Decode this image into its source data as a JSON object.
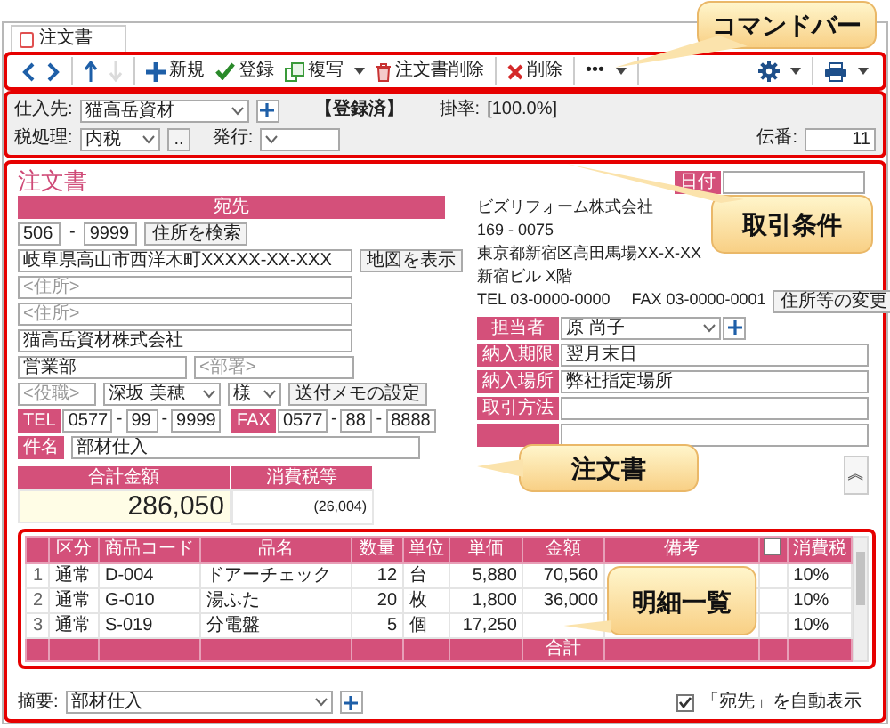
{
  "tab": {
    "label": "注文書",
    "selected": true
  },
  "toolbar": {
    "groups": [
      {
        "items": [
          {
            "kind": "prev",
            "disabled": false,
            "dropdown": false
          },
          {
            "kind": "next",
            "disabled": false,
            "dropdown": false
          }
        ]
      },
      {
        "items": [
          {
            "kind": "up",
            "disabled": false,
            "dropdown": false
          },
          {
            "kind": "down",
            "disabled": true,
            "dropdown": false
          }
        ]
      },
      {
        "items": [
          {
            "kind": "new",
            "label": "新規",
            "disabled": false,
            "dropdown": false
          },
          {
            "kind": "save",
            "label": "登録",
            "disabled": false,
            "dropdown": false
          },
          {
            "kind": "copy",
            "label": "複写",
            "disabled": false,
            "dropdown": true
          },
          {
            "kind": "trash",
            "label": "注文書削除",
            "disabled": false,
            "dropdown": false
          }
        ]
      },
      {
        "items": [
          {
            "kind": "delete",
            "label": "削除",
            "disabled": false,
            "dropdown": false
          }
        ]
      },
      {
        "items": [
          {
            "kind": "more",
            "label": "•••",
            "disabled": false,
            "dropdown": true
          }
        ]
      }
    ],
    "right_groups": [
      {
        "items": [
          {
            "kind": "settings",
            "disabled": false,
            "dropdown": true
          }
        ]
      },
      {
        "items": [
          {
            "kind": "print",
            "disabled": false,
            "dropdown": true
          }
        ]
      }
    ]
  },
  "conditions": {
    "supplier_label": "仕入先:",
    "supplier": "猫高岳資材",
    "status": "【登録済】",
    "rate_label": "掛率:",
    "rate": "[100.0%]",
    "tax_label": "税処理:",
    "tax": "内税",
    "tax_more": "..",
    "issue_label": "発行:",
    "slip_label": "伝番:",
    "slip": "11"
  },
  "form": {
    "title": "注文書",
    "recipient": {
      "band": "宛先",
      "zip": [
        "506",
        "9999"
      ],
      "zip_separator": "-",
      "zip_search": "住所を検索",
      "address": "岐阜県高山市西洋木町XXXXX-XX-XXX",
      "map_button": "地図を表示",
      "address_placeholders": [
        "<住所>",
        "<住所>"
      ],
      "company": "猫高岳資材株式会社",
      "department": "営業部",
      "department_placeholder": "<部署>",
      "position_placeholder": "<役職>",
      "person": "深坂 美穂",
      "honorific": "様",
      "memo_button": "送付メモの設定",
      "phones": [
        {
          "label": "TEL",
          "parts": [
            "0577",
            "99",
            "9999"
          ],
          "separators": [
            "-",
            "-"
          ]
        },
        {
          "label": "FAX",
          "parts": [
            "0577",
            "88",
            "8888"
          ],
          "separators": [
            "-",
            "-"
          ]
        }
      ],
      "subject_label": "件名",
      "subject": "部材仕入",
      "total_label": "合計金額",
      "total": "286,050",
      "tax_label": "消費税等",
      "tax": "(26,004)"
    },
    "sender": {
      "date_label": "日付",
      "company": "ビズリフォーム株式会社",
      "zip": "169 - 0075",
      "address": "東京都新宿区高田馬場XX-X-XX",
      "building": "新宿ビル X階",
      "tel": "TEL 03-0000-0000",
      "fax": "FAX 03-0000-0001",
      "change_button": "住所等の変更",
      "fields": [
        {
          "kind": "select",
          "label": "担当者",
          "value": "原 尚子"
        },
        {
          "kind": "text",
          "label": "納入期限",
          "value": "翌月末日"
        },
        {
          "kind": "text",
          "label": "納入場所",
          "value": "弊社指定場所"
        },
        {
          "kind": "text",
          "label": "取引方法"
        },
        {
          "kind": "text"
        }
      ],
      "collapse": "︽"
    }
  },
  "details": {
    "columns": [
      {
        "kind": "index"
      },
      {
        "kind": "text",
        "label": "区分"
      },
      {
        "kind": "text",
        "label": "商品コード"
      },
      {
        "kind": "text",
        "label": "品名"
      },
      {
        "kind": "number",
        "label": "数量"
      },
      {
        "kind": "text",
        "label": "単位"
      },
      {
        "kind": "number",
        "label": "単価"
      },
      {
        "kind": "number",
        "label": "金額"
      },
      {
        "kind": "text",
        "label": "備考"
      },
      {
        "kind": "checkbox",
        "checked": false
      },
      {
        "kind": "text",
        "label": "消費税"
      }
    ],
    "rows": [
      {
        "no": "1",
        "category": "通常",
        "code": "D-004",
        "name": "ドアーチェック",
        "qty": "12",
        "unit": "台",
        "price": "5,880",
        "amount": "70,560",
        "tax": "10%"
      },
      {
        "no": "2",
        "category": "通常",
        "code": "G-010",
        "name": "湯ふた",
        "qty": "20",
        "unit": "枚",
        "price": "1,800",
        "amount": "36,000",
        "tax": "10%"
      },
      {
        "no": "3",
        "category": "通常",
        "code": "S-019",
        "name": "分電盤",
        "qty": "5",
        "unit": "個",
        "price": "17,250",
        "tax": "10%"
      }
    ],
    "total_label": "合計"
  },
  "footer": {
    "memo_label": "摘要:",
    "memo": "部材仕入",
    "auto_checked": true,
    "auto_label": "「宛先」を自動表示"
  },
  "callouts": [
    {
      "label": "コマンドバー"
    },
    {
      "label": "取引条件"
    },
    {
      "label": "注文書"
    },
    {
      "label": "明細一覧"
    }
  ]
}
